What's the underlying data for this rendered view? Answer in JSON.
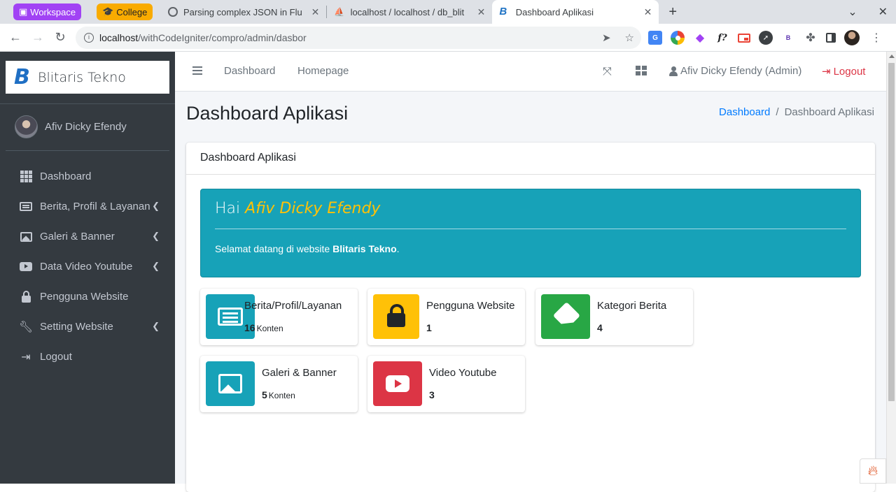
{
  "browser": {
    "groups": [
      {
        "label": "Workspace",
        "color": "#a142f4"
      },
      {
        "label": "College",
        "color": "#f9ab00"
      }
    ],
    "tabs": [
      {
        "title": "Parsing complex JSON in Flut"
      },
      {
        "title": "localhost / localhost / db_blit"
      },
      {
        "title": "Dashboard Aplikasi"
      }
    ],
    "url_host": "localhost",
    "url_path": "/withCodeIgniter/compro/admin/dasbor"
  },
  "sidebar": {
    "brand_text": "Blitaris Tekno",
    "brand_letter": "B",
    "user_name": "Afiv Dicky Efendy",
    "items": [
      {
        "label": "Dashboard",
        "icon": "grid-icon",
        "caret": false
      },
      {
        "label": "Berita, Profil & Layanan",
        "icon": "newspaper-icon",
        "caret": true
      },
      {
        "label": "Galeri & Banner",
        "icon": "image-icon",
        "caret": true
      },
      {
        "label": "Data Video Youtube",
        "icon": "youtube-icon",
        "caret": true
      },
      {
        "label": "Pengguna Website",
        "icon": "lock-icon",
        "caret": false
      },
      {
        "label": "Setting Website",
        "icon": "wrench-icon",
        "caret": true
      },
      {
        "label": "Logout",
        "icon": "sign-out-icon",
        "caret": false
      }
    ]
  },
  "navbar": {
    "dashboard_link": "Dashboard",
    "homepage_link": "Homepage",
    "user_label": "Afiv Dicky Efendy (Admin)",
    "logout_label": "Logout"
  },
  "page": {
    "title": "Dashboard Aplikasi",
    "breadcrumb": [
      "Dashboard",
      "Dashboard Aplikasi"
    ],
    "card_title": "Dashboard Aplikasi",
    "greeting": "Hai",
    "greeting_name": "Afiv Dicky Efendy",
    "welcome_prefix": "Selamat datang di website ",
    "welcome_site": "Blitaris Tekno",
    "welcome_suffix": "."
  },
  "stats": [
    {
      "label": "Berita/Profil/Layanan",
      "value": "16",
      "unit": "Konten",
      "color": "#17a2b8",
      "icon": "newspaper-icon"
    },
    {
      "label": "Pengguna Website",
      "value": "1",
      "unit": "",
      "color": "#ffc107",
      "icon": "lock-icon"
    },
    {
      "label": "Kategori Berita",
      "value": "4",
      "unit": "",
      "color": "#28a745",
      "icon": "tags-icon"
    },
    {
      "label": "Galeri & Banner",
      "value": "5",
      "unit": "Konten",
      "color": "#17a2b8",
      "icon": "images-icon"
    },
    {
      "label": "Video Youtube",
      "value": "3",
      "unit": "",
      "color": "#dc3545",
      "icon": "youtube-icon"
    }
  ]
}
